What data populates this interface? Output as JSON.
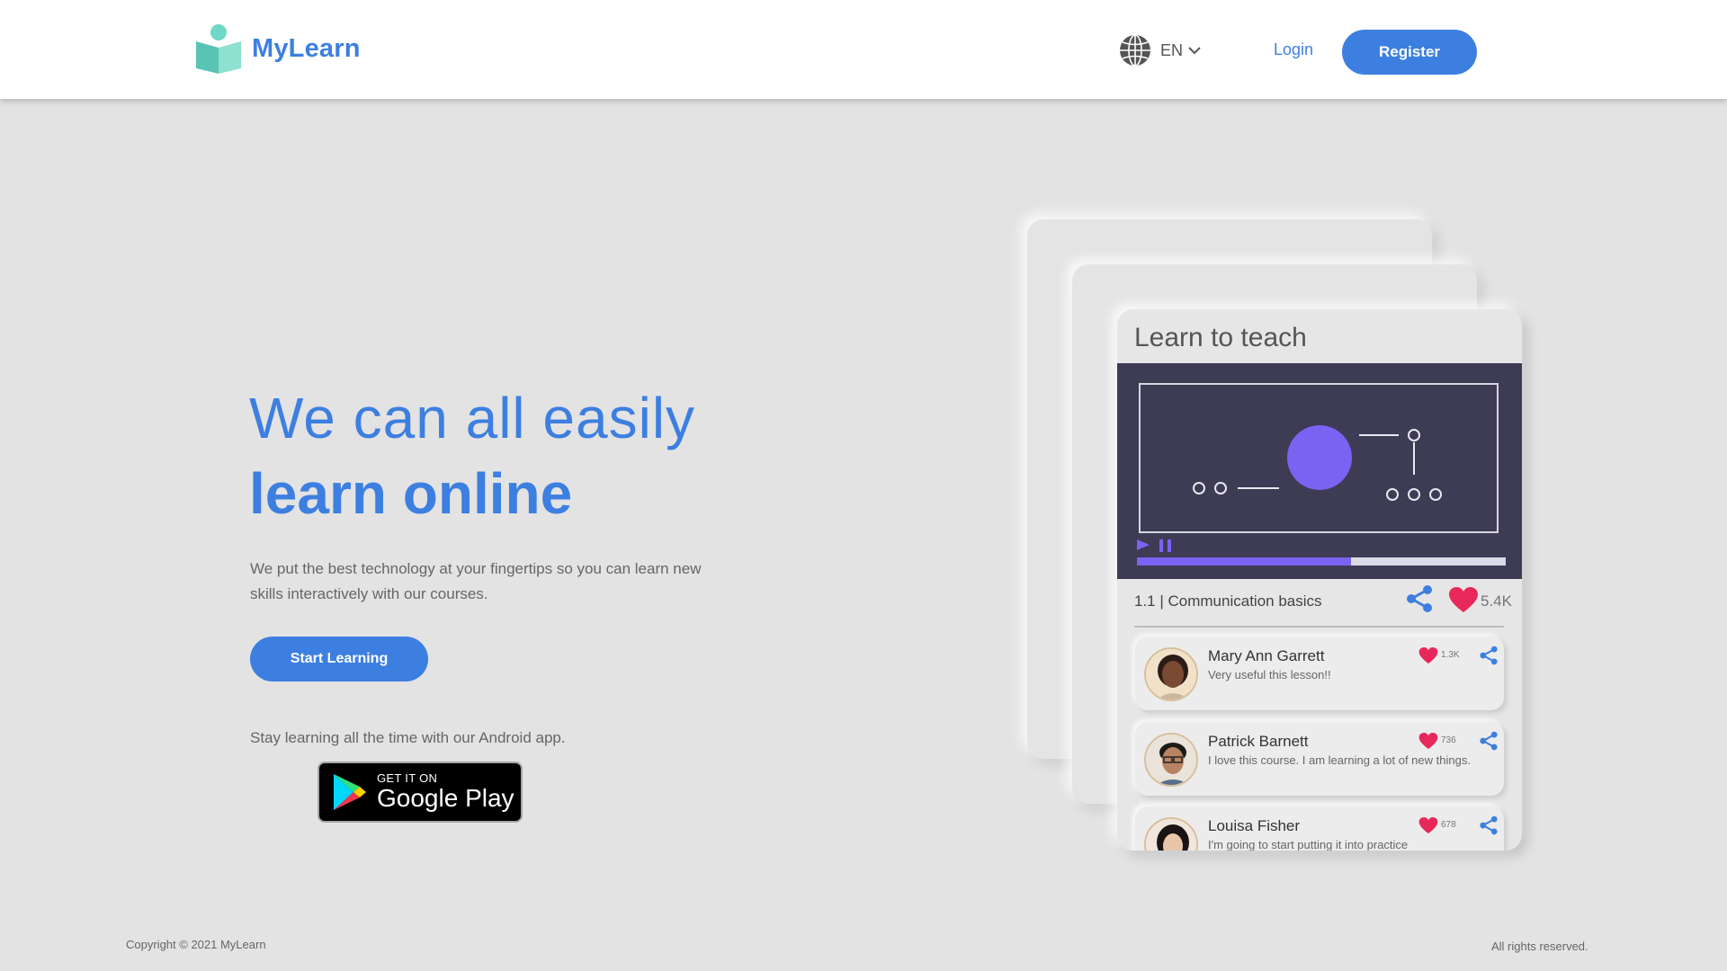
{
  "brand": {
    "name": "MyLearn",
    "logo_icon": "book-person-icon"
  },
  "header": {
    "language": "EN",
    "login_label": "Login",
    "register_label": "Register"
  },
  "hero": {
    "line1": "We can all easily",
    "line2": "learn online",
    "description": "We put the best technology at your fingertips so you can learn new skills interactively with our courses.",
    "start_label": "Start Learning",
    "app_text": "Stay learning all the time with our Android app.",
    "store_small": "GET IT ON",
    "store_big": "Google Play"
  },
  "course_card": {
    "title": "Learn to teach",
    "video_progress": 0.58,
    "lesson_title": "1.1 | Communication basics",
    "lesson_likes": "5.4K",
    "comments": [
      {
        "name": "Mary Ann Garrett",
        "text": "Very useful this lesson!!",
        "likes": "1.3K"
      },
      {
        "name": "Patrick Barnett",
        "text": "I love this course. I am learning a lot of new things.",
        "likes": "736"
      },
      {
        "name": "Louisa Fisher",
        "text": "I'm going to start putting it into practice",
        "likes": "678"
      }
    ]
  },
  "footer": {
    "copyright": "Copyright © 2021 MyLearn",
    "rights": "All rights reserved."
  },
  "colors": {
    "primary": "#3d7fe0",
    "heart": "#e8285a",
    "video_bg": "#3e3b55",
    "video_accent": "#7a63f2",
    "page_bg": "#e3e3e3"
  }
}
